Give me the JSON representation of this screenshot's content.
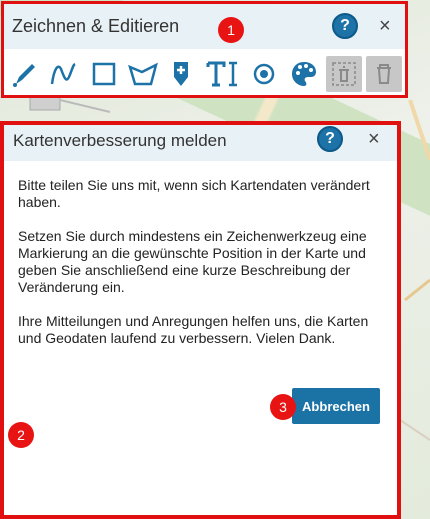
{
  "panel1": {
    "title": "Zeichnen & Editieren",
    "help_label": "?",
    "close_label": "×",
    "tools": [
      {
        "name": "pencil-icon"
      },
      {
        "name": "freehand-curve-icon"
      },
      {
        "name": "rectangle-icon"
      },
      {
        "name": "polygon-icon"
      },
      {
        "name": "marker-plus-icon"
      },
      {
        "name": "text-tool-icon"
      },
      {
        "name": "circle-point-icon"
      },
      {
        "name": "palette-icon"
      },
      {
        "name": "delete-selection-icon",
        "disabled": true
      },
      {
        "name": "trash-icon",
        "disabled": true
      }
    ]
  },
  "panel2": {
    "title": "Kartenverbesserung melden",
    "help_label": "?",
    "close_label": "×",
    "paragraphs": [
      "Bitte teilen Sie uns mit, wenn sich Kartendaten verändert haben.",
      "Setzen Sie durch mindestens ein Zeichenwerkzeug eine Markierung an die gewünschte Position in der Karte und geben Sie anschließend eine kurze Beschreibung der Veränderung ein.",
      "Ihre Mitteilungen und Anregungen helfen uns, die Karten und Geodaten laufend zu verbessern. Vielen Dank."
    ],
    "cancel_label": "Abbrechen"
  },
  "badges": [
    "1",
    "2",
    "3"
  ],
  "colors": {
    "accent": "#1a72a5",
    "highlight": "#e01010",
    "header_bg": "#e8f1f6"
  }
}
